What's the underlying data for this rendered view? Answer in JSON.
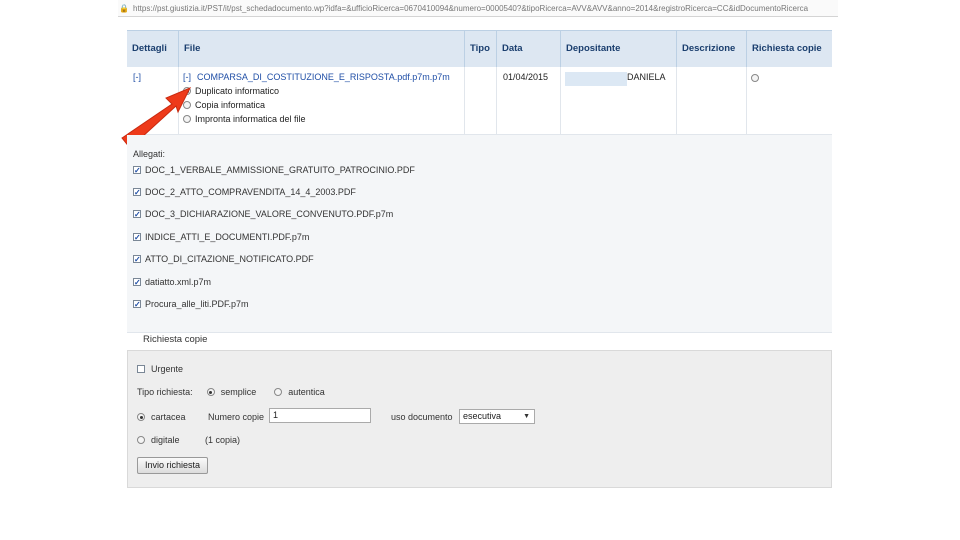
{
  "address_bar": {
    "url": "https://pst.giustizia.it/PST/it/pst_schedadocumento.wp?idfa=&ufficioRicerca=0670410094&numero=0000540?&tipoRicerca=AVV&AVV&anno=2014&registroRicerca=CC&idDocumentoRicerca"
  },
  "table": {
    "headers": [
      "Dettagli",
      "File",
      "Tipo",
      "Data",
      "Depositante",
      "Descrizione",
      "Richiesta copie"
    ],
    "row": {
      "dettagli": "[-]",
      "file_toggle": "[-]",
      "file_name": "COMPARSA_DI_COSTITUZIONE_E_RISPOSTA.pdf.p7m.p7m",
      "file_options": [
        {
          "label": "Duplicato informatico",
          "checked": true
        },
        {
          "label": "Copia informatica",
          "checked": false
        },
        {
          "label": "Impronta informatica del file",
          "checked": false
        }
      ],
      "data": "01/04/2015",
      "depositante": "DANIELA"
    }
  },
  "allegati": {
    "title": "Allegati:",
    "items": [
      "DOC_1_VERBALE_AMMISSIONE_GRATUITO_PATROCINIO.PDF",
      "DOC_2_ATTO_COMPRAVENDITA_14_4_2003.PDF",
      "DOC_3_DICHIARAZIONE_VALORE_CONVENUTO.PDF.p7m",
      "INDICE_ATTI_E_DOCUMENTI.PDF.p7m",
      "ATTO_DI_CITAZIONE_NOTIFICATO.PDF",
      "datiatto.xml.p7m",
      "Procura_alle_liti.PDF.p7m"
    ]
  },
  "richiesta_copie": {
    "legend": "Richiesta copie",
    "urgente_label": "Urgente",
    "tipo_label": "Tipo richiesta:",
    "tipo_semplice": "semplice",
    "tipo_autentica": "autentica",
    "cartacea_label": "cartacea",
    "numero_copie_label": "Numero copie",
    "numero_copie_value": "1",
    "uso_documento_label": "uso documento",
    "uso_documento_value": "esecutiva",
    "digitale_label": "digitale",
    "digitale_note": "(1 copia)",
    "submit_label": "Invio richiesta"
  }
}
